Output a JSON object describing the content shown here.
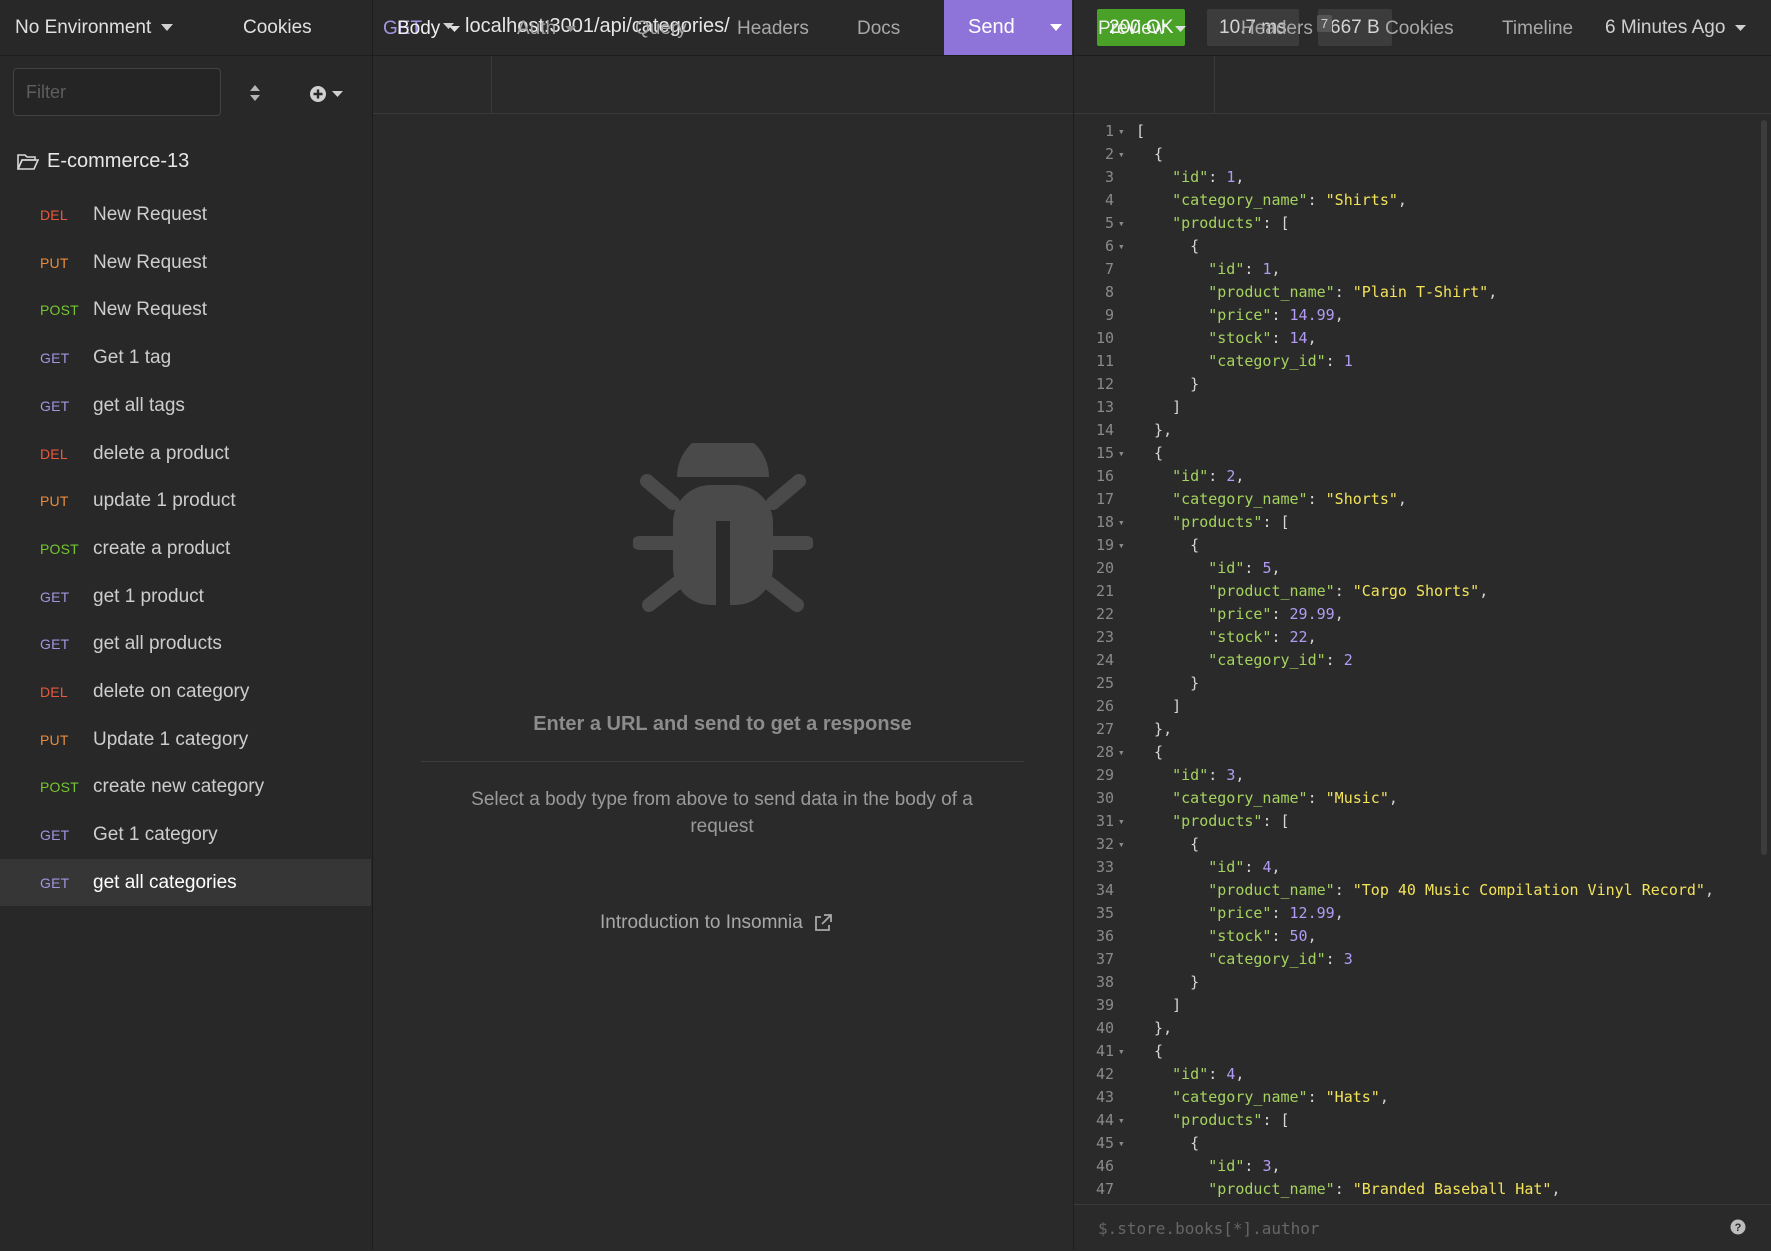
{
  "sidebar": {
    "environment": "No Environment",
    "cookies": "Cookies",
    "filter_placeholder": "Filter",
    "folder": "E-commerce-13",
    "requests": [
      {
        "method": "DEL",
        "name": "New Request"
      },
      {
        "method": "PUT",
        "name": "New Request"
      },
      {
        "method": "POST",
        "name": "New Request"
      },
      {
        "method": "GET",
        "name": "Get 1 tag"
      },
      {
        "method": "GET",
        "name": "get all tags"
      },
      {
        "method": "DEL",
        "name": "delete a product"
      },
      {
        "method": "PUT",
        "name": "update 1 product"
      },
      {
        "method": "POST",
        "name": "create a product"
      },
      {
        "method": "GET",
        "name": "get 1 product"
      },
      {
        "method": "GET",
        "name": "get all products"
      },
      {
        "method": "DEL",
        "name": "delete on category"
      },
      {
        "method": "PUT",
        "name": "Update 1 category"
      },
      {
        "method": "POST",
        "name": "create new category"
      },
      {
        "method": "GET",
        "name": "Get 1 category"
      },
      {
        "method": "GET",
        "name": "get all categories",
        "active": true
      }
    ]
  },
  "request": {
    "method": "GET",
    "url": "localhost:3001/api/categories/",
    "send_label": "Send",
    "tabs": {
      "body": "Body",
      "auth": "Auth",
      "query": "Query",
      "headers": "Headers",
      "docs": "Docs"
    },
    "empty_title": "Enter a URL and send to get a response",
    "empty_hint": "Select a body type from above to send data in the body of a request",
    "intro_link": "Introduction to Insomnia"
  },
  "response": {
    "status": "200 OK",
    "time": "10.7 ms",
    "size": "667 B",
    "history": "6 Minutes Ago",
    "tabs": {
      "preview": "Preview",
      "headers": "Headers",
      "headers_count": "7",
      "cookies": "Cookies",
      "timeline": "Timeline"
    },
    "filter_placeholder": "$.store.books[*].author",
    "code_lines": [
      {
        "n": "1",
        "fold": true,
        "tokens": [
          [
            "punct",
            "["
          ]
        ]
      },
      {
        "n": "2",
        "fold": true,
        "tokens": [
          [
            "punct",
            "  {"
          ]
        ]
      },
      {
        "n": "3",
        "tokens": [
          [
            "punct",
            "    "
          ],
          [
            "key",
            "\"id\""
          ],
          [
            "punct",
            ": "
          ],
          [
            "number",
            "1"
          ],
          [
            "punct",
            ","
          ]
        ]
      },
      {
        "n": "4",
        "tokens": [
          [
            "punct",
            "    "
          ],
          [
            "key",
            "\"category_name\""
          ],
          [
            "punct",
            ": "
          ],
          [
            "string",
            "\"Shirts\""
          ],
          [
            "punct",
            ","
          ]
        ]
      },
      {
        "n": "5",
        "fold": true,
        "tokens": [
          [
            "punct",
            "    "
          ],
          [
            "key",
            "\"products\""
          ],
          [
            "punct",
            ": ["
          ]
        ]
      },
      {
        "n": "6",
        "fold": true,
        "tokens": [
          [
            "punct",
            "      {"
          ]
        ]
      },
      {
        "n": "7",
        "tokens": [
          [
            "punct",
            "        "
          ],
          [
            "key",
            "\"id\""
          ],
          [
            "punct",
            ": "
          ],
          [
            "number",
            "1"
          ],
          [
            "punct",
            ","
          ]
        ]
      },
      {
        "n": "8",
        "tokens": [
          [
            "punct",
            "        "
          ],
          [
            "key",
            "\"product_name\""
          ],
          [
            "punct",
            ": "
          ],
          [
            "string",
            "\"Plain T-Shirt\""
          ],
          [
            "punct",
            ","
          ]
        ]
      },
      {
        "n": "9",
        "tokens": [
          [
            "punct",
            "        "
          ],
          [
            "key",
            "\"price\""
          ],
          [
            "punct",
            ": "
          ],
          [
            "number",
            "14.99"
          ],
          [
            "punct",
            ","
          ]
        ]
      },
      {
        "n": "10",
        "tokens": [
          [
            "punct",
            "        "
          ],
          [
            "key",
            "\"stock\""
          ],
          [
            "punct",
            ": "
          ],
          [
            "number",
            "14"
          ],
          [
            "punct",
            ","
          ]
        ]
      },
      {
        "n": "11",
        "tokens": [
          [
            "punct",
            "        "
          ],
          [
            "key",
            "\"category_id\""
          ],
          [
            "punct",
            ": "
          ],
          [
            "number",
            "1"
          ]
        ]
      },
      {
        "n": "12",
        "tokens": [
          [
            "punct",
            "      }"
          ]
        ]
      },
      {
        "n": "13",
        "tokens": [
          [
            "punct",
            "    ]"
          ]
        ]
      },
      {
        "n": "14",
        "tokens": [
          [
            "punct",
            "  },"
          ]
        ]
      },
      {
        "n": "15",
        "fold": true,
        "tokens": [
          [
            "punct",
            "  {"
          ]
        ]
      },
      {
        "n": "16",
        "tokens": [
          [
            "punct",
            "    "
          ],
          [
            "key",
            "\"id\""
          ],
          [
            "punct",
            ": "
          ],
          [
            "number",
            "2"
          ],
          [
            "punct",
            ","
          ]
        ]
      },
      {
        "n": "17",
        "tokens": [
          [
            "punct",
            "    "
          ],
          [
            "key",
            "\"category_name\""
          ],
          [
            "punct",
            ": "
          ],
          [
            "string",
            "\"Shorts\""
          ],
          [
            "punct",
            ","
          ]
        ]
      },
      {
        "n": "18",
        "fold": true,
        "tokens": [
          [
            "punct",
            "    "
          ],
          [
            "key",
            "\"products\""
          ],
          [
            "punct",
            ": ["
          ]
        ]
      },
      {
        "n": "19",
        "fold": true,
        "tokens": [
          [
            "punct",
            "      {"
          ]
        ]
      },
      {
        "n": "20",
        "tokens": [
          [
            "punct",
            "        "
          ],
          [
            "key",
            "\"id\""
          ],
          [
            "punct",
            ": "
          ],
          [
            "number",
            "5"
          ],
          [
            "punct",
            ","
          ]
        ]
      },
      {
        "n": "21",
        "tokens": [
          [
            "punct",
            "        "
          ],
          [
            "key",
            "\"product_name\""
          ],
          [
            "punct",
            ": "
          ],
          [
            "string",
            "\"Cargo Shorts\""
          ],
          [
            "punct",
            ","
          ]
        ]
      },
      {
        "n": "22",
        "tokens": [
          [
            "punct",
            "        "
          ],
          [
            "key",
            "\"price\""
          ],
          [
            "punct",
            ": "
          ],
          [
            "number",
            "29.99"
          ],
          [
            "punct",
            ","
          ]
        ]
      },
      {
        "n": "23",
        "tokens": [
          [
            "punct",
            "        "
          ],
          [
            "key",
            "\"stock\""
          ],
          [
            "punct",
            ": "
          ],
          [
            "number",
            "22"
          ],
          [
            "punct",
            ","
          ]
        ]
      },
      {
        "n": "24",
        "tokens": [
          [
            "punct",
            "        "
          ],
          [
            "key",
            "\"category_id\""
          ],
          [
            "punct",
            ": "
          ],
          [
            "number",
            "2"
          ]
        ]
      },
      {
        "n": "25",
        "tokens": [
          [
            "punct",
            "      }"
          ]
        ]
      },
      {
        "n": "26",
        "tokens": [
          [
            "punct",
            "    ]"
          ]
        ]
      },
      {
        "n": "27",
        "tokens": [
          [
            "punct",
            "  },"
          ]
        ]
      },
      {
        "n": "28",
        "fold": true,
        "tokens": [
          [
            "punct",
            "  {"
          ]
        ]
      },
      {
        "n": "29",
        "tokens": [
          [
            "punct",
            "    "
          ],
          [
            "key",
            "\"id\""
          ],
          [
            "punct",
            ": "
          ],
          [
            "number",
            "3"
          ],
          [
            "punct",
            ","
          ]
        ]
      },
      {
        "n": "30",
        "tokens": [
          [
            "punct",
            "    "
          ],
          [
            "key",
            "\"category_name\""
          ],
          [
            "punct",
            ": "
          ],
          [
            "string",
            "\"Music\""
          ],
          [
            "punct",
            ","
          ]
        ]
      },
      {
        "n": "31",
        "fold": true,
        "tokens": [
          [
            "punct",
            "    "
          ],
          [
            "key",
            "\"products\""
          ],
          [
            "punct",
            ": ["
          ]
        ]
      },
      {
        "n": "32",
        "fold": true,
        "tokens": [
          [
            "punct",
            "      {"
          ]
        ]
      },
      {
        "n": "33",
        "tokens": [
          [
            "punct",
            "        "
          ],
          [
            "key",
            "\"id\""
          ],
          [
            "punct",
            ": "
          ],
          [
            "number",
            "4"
          ],
          [
            "punct",
            ","
          ]
        ]
      },
      {
        "n": "34",
        "tokens": [
          [
            "punct",
            "        "
          ],
          [
            "key",
            "\"product_name\""
          ],
          [
            "punct",
            ": "
          ],
          [
            "string",
            "\"Top 40 Music Compilation Vinyl Record\""
          ],
          [
            "punct",
            ","
          ]
        ]
      },
      {
        "n": "35",
        "tokens": [
          [
            "punct",
            "        "
          ],
          [
            "key",
            "\"price\""
          ],
          [
            "punct",
            ": "
          ],
          [
            "number",
            "12.99"
          ],
          [
            "punct",
            ","
          ]
        ]
      },
      {
        "n": "36",
        "tokens": [
          [
            "punct",
            "        "
          ],
          [
            "key",
            "\"stock\""
          ],
          [
            "punct",
            ": "
          ],
          [
            "number",
            "50"
          ],
          [
            "punct",
            ","
          ]
        ]
      },
      {
        "n": "37",
        "tokens": [
          [
            "punct",
            "        "
          ],
          [
            "key",
            "\"category_id\""
          ],
          [
            "punct",
            ": "
          ],
          [
            "number",
            "3"
          ]
        ]
      },
      {
        "n": "38",
        "tokens": [
          [
            "punct",
            "      }"
          ]
        ]
      },
      {
        "n": "39",
        "tokens": [
          [
            "punct",
            "    ]"
          ]
        ]
      },
      {
        "n": "40",
        "tokens": [
          [
            "punct",
            "  },"
          ]
        ]
      },
      {
        "n": "41",
        "fold": true,
        "tokens": [
          [
            "punct",
            "  {"
          ]
        ]
      },
      {
        "n": "42",
        "tokens": [
          [
            "punct",
            "    "
          ],
          [
            "key",
            "\"id\""
          ],
          [
            "punct",
            ": "
          ],
          [
            "number",
            "4"
          ],
          [
            "punct",
            ","
          ]
        ]
      },
      {
        "n": "43",
        "tokens": [
          [
            "punct",
            "    "
          ],
          [
            "key",
            "\"category_name\""
          ],
          [
            "punct",
            ": "
          ],
          [
            "string",
            "\"Hats\""
          ],
          [
            "punct",
            ","
          ]
        ]
      },
      {
        "n": "44",
        "fold": true,
        "tokens": [
          [
            "punct",
            "    "
          ],
          [
            "key",
            "\"products\""
          ],
          [
            "punct",
            ": ["
          ]
        ]
      },
      {
        "n": "45",
        "fold": true,
        "tokens": [
          [
            "punct",
            "      {"
          ]
        ]
      },
      {
        "n": "46",
        "tokens": [
          [
            "punct",
            "        "
          ],
          [
            "key",
            "\"id\""
          ],
          [
            "punct",
            ": "
          ],
          [
            "number",
            "3"
          ],
          [
            "punct",
            ","
          ]
        ]
      },
      {
        "n": "47",
        "tokens": [
          [
            "punct",
            "        "
          ],
          [
            "key",
            "\"product_name\""
          ],
          [
            "punct",
            ": "
          ],
          [
            "string",
            "\"Branded Baseball Hat\""
          ],
          [
            "punct",
            ","
          ]
        ]
      }
    ]
  },
  "colors": {
    "accent": "#8e74d8",
    "status_ok": "#4aa128",
    "method_get": "#a295df",
    "method_post": "#75c72f",
    "method_put": "#ea8c3a",
    "method_del": "#e8593f"
  },
  "icons": [
    "chevron-down-icon",
    "sort-icon",
    "plus-circle-icon",
    "folder-open-icon",
    "bug-icon",
    "external-link-icon",
    "help-icon"
  ]
}
